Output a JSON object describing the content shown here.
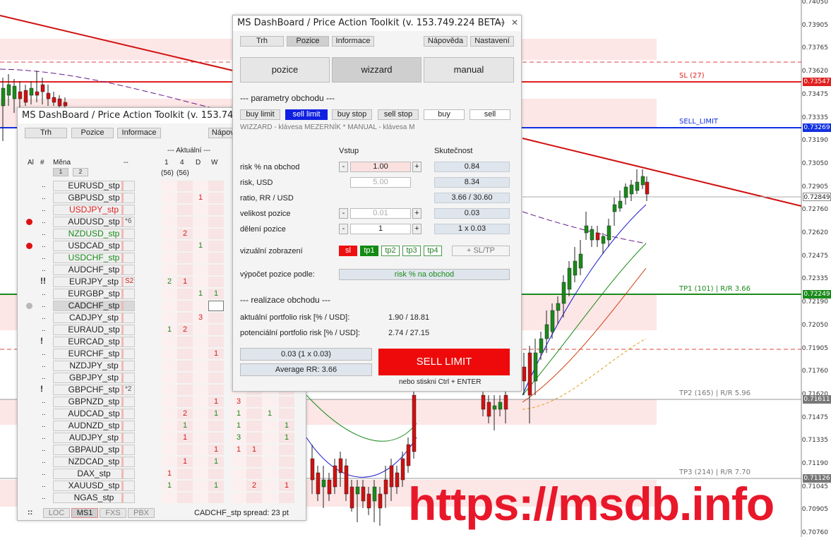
{
  "price_axis": [
    "0.74050",
    "0.73905",
    "0.73765",
    "0.73620",
    "0.73475",
    "0.73335",
    "0.73190",
    "0.73050",
    "0.72905",
    "0.72760",
    "0.72620",
    "0.72475",
    "0.72335",
    "0.72190",
    "0.72050",
    "0.71905",
    "0.71760",
    "0.71620",
    "0.71475",
    "0.71335",
    "0.71190",
    "0.71045",
    "0.70905",
    "0.70760"
  ],
  "levels": {
    "sl": {
      "label": "SL (27)",
      "price": "0.73547",
      "color": "#e02020"
    },
    "sell_limit": {
      "label": "SELL_LIMIT",
      "price": "0.73269",
      "color": "#1030e0"
    },
    "current": {
      "price": "0.72849"
    },
    "tp1": {
      "label": "TP1 (101) | R/R 3.66",
      "price": "0.72249",
      "color": "#1a8a1a"
    },
    "tp2": {
      "label": "TP2 (165) | R/R 5.96",
      "price": "0.71611"
    },
    "tp3": {
      "label": "TP3 (214) | R/R 7.70",
      "price": "0.71126"
    }
  },
  "watermark": "https://msdb.info",
  "back_window": {
    "title": "MS DashBoard / Price Action Toolkit (v. 153.749.224 BETA)",
    "tabs": [
      "Trh",
      "Pozice",
      "Informace",
      "Nápověda"
    ],
    "section_label": "--- Aktuální ---",
    "col_al": "Al",
    "col_hash": "#",
    "col_mena": "Měna",
    "col_dash": "--",
    "page_btns": [
      "1",
      "2"
    ],
    "tf_cols": [
      "1",
      "4",
      "D",
      "W"
    ],
    "counts": [
      "(56)",
      "(56)"
    ],
    "symbols": [
      {
        "name": "EURUSD_stp",
        "color": "#222"
      },
      {
        "name": "GBPUSD_stp",
        "color": "#222",
        "cells": [
          {
            "c": 2,
            "v": "1",
            "color": "#d02020"
          }
        ]
      },
      {
        "name": "USDJPY_stp",
        "color": "#e02020"
      },
      {
        "name": "AUDUSD_stp",
        "color": "#222",
        "dot": "#e01010",
        "note": "*6"
      },
      {
        "name": "NZDUSD_stp",
        "color": "#1a8a1a",
        "cells": [
          {
            "c": 1,
            "v": "2",
            "color": "#d02020"
          }
        ]
      },
      {
        "name": "USDCAD_stp",
        "color": "#222",
        "dot": "#e01010",
        "cells": [
          {
            "c": 2,
            "v": "1",
            "color": "#1a8a1a"
          }
        ]
      },
      {
        "name": "USDCHF_stp",
        "color": "#1a8a1a"
      },
      {
        "name": "AUDCHF_stp",
        "color": "#222"
      },
      {
        "name": "EURJPY_stp",
        "color": "#222",
        "pre": "!!",
        "note": "S2",
        "note_color": "#d02020",
        "cells": [
          {
            "c": 0,
            "v": "2",
            "color": "#1a8a1a"
          },
          {
            "c": 1,
            "v": "1",
            "color": "#d02020"
          }
        ]
      },
      {
        "name": "EURGBP_stp",
        "color": "#222",
        "cells": [
          {
            "c": 2,
            "v": "1",
            "color": "#1a8a1a"
          },
          {
            "c": 3,
            "v": "1",
            "color": "#1a8a1a"
          }
        ]
      },
      {
        "name": "CADCHF_stp",
        "color": "#222",
        "dot": "#b8b8b8",
        "selected": true
      },
      {
        "name": "CADJPY_stp",
        "color": "#222",
        "cells": [
          {
            "c": 2,
            "v": "3",
            "color": "#d02020"
          }
        ]
      },
      {
        "name": "EURAUD_stp",
        "color": "#222",
        "cells": [
          {
            "c": 0,
            "v": "1",
            "color": "#1a8a1a"
          },
          {
            "c": 1,
            "v": "2",
            "color": "#d02020"
          }
        ]
      },
      {
        "name": "EURCAD_stp",
        "color": "#222",
        "pre": "!"
      },
      {
        "name": "EURCHF_stp",
        "color": "#222",
        "cells": [
          {
            "c": 3,
            "v": "1",
            "color": "#d02020"
          }
        ]
      },
      {
        "name": "NZDJPY_stp",
        "color": "#222"
      },
      {
        "name": "GBPJPY_stp",
        "color": "#222"
      },
      {
        "name": "GBPCHF_stp",
        "color": "#222",
        "pre": "!",
        "note": "*2"
      },
      {
        "name": "GBPNZD_stp",
        "color": "#222",
        "cells": [
          {
            "c": 3,
            "v": "1",
            "color": "#d02020"
          },
          {
            "c": 4,
            "v": "3",
            "color": "#d02020"
          }
        ]
      },
      {
        "name": "AUDCAD_stp",
        "color": "#222",
        "cells": [
          {
            "c": 1,
            "v": "2",
            "color": "#d02020"
          },
          {
            "c": 3,
            "v": "1",
            "color": "#1a8a1a"
          },
          {
            "c": 4,
            "v": "1",
            "color": "#1a8a1a"
          },
          {
            "c": 6,
            "v": "1",
            "color": "#1a8a1a"
          }
        ]
      },
      {
        "name": "AUDNZD_stp",
        "color": "#222",
        "cells": [
          {
            "c": 1,
            "v": "1",
            "color": "#1a8a1a"
          },
          {
            "c": 4,
            "v": "1",
            "color": "#1a8a1a"
          },
          {
            "c": 7,
            "v": "1",
            "color": "#1a8a1a"
          }
        ]
      },
      {
        "name": "AUDJPY_stp",
        "color": "#222",
        "cells": [
          {
            "c": 1,
            "v": "1",
            "color": "#d02020"
          },
          {
            "c": 4,
            "v": "3",
            "color": "#1a8a1a"
          },
          {
            "c": 7,
            "v": "1",
            "color": "#1a8a1a"
          }
        ]
      },
      {
        "name": "GBPAUD_stp",
        "color": "#222",
        "cells": [
          {
            "c": 3,
            "v": "1",
            "color": "#d02020"
          },
          {
            "c": 4,
            "v": "1",
            "color": "#d02020"
          },
          {
            "c": 5,
            "v": "1",
            "color": "#d02020"
          }
        ]
      },
      {
        "name": "NZDCAD_stp",
        "color": "#222",
        "cells": [
          {
            "c": 1,
            "v": "1",
            "color": "#d02020"
          },
          {
            "c": 3,
            "v": "1",
            "color": "#1a8a1a"
          }
        ]
      },
      {
        "name": "DAX_stp",
        "color": "#222",
        "cells": [
          {
            "c": 0,
            "v": "1",
            "color": "#d02020"
          }
        ]
      },
      {
        "name": "XAUUSD_stp",
        "color": "#222",
        "cells": [
          {
            "c": 0,
            "v": "1",
            "color": "#1a8a1a"
          },
          {
            "c": 3,
            "v": "1",
            "color": "#1a8a1a"
          },
          {
            "c": 5,
            "v": "2",
            "color": "#d02020"
          },
          {
            "c": 7,
            "v": "1",
            "color": "#d02020"
          }
        ]
      },
      {
        "name": "NGAS_stp",
        "color": "#222"
      }
    ],
    "footer": {
      "grip": "::",
      "tabs": [
        "LOC",
        "MS1",
        "FXS",
        "PBX"
      ],
      "spread": "CADCHF_stp spread: 23 pt"
    }
  },
  "front_window": {
    "title": "MS DashBoard / Price Action Toolkit (v. 153.749.224 BETA)",
    "minimize": "—",
    "close": "✕",
    "tabs": [
      "Trh",
      "Pozice",
      "Informace"
    ],
    "help": "Nápověda",
    "settings": "Nastavení",
    "modes": [
      "pozice",
      "wizzard",
      "manual"
    ],
    "params_title": "--- parametry obchodu ---",
    "order_types": [
      "buy limit",
      "sell limit",
      "buy stop",
      "sell stop",
      "buy",
      "sell"
    ],
    "hint": "WIZZARD - klávesa MEZERNÍK * MANUAL - klávesa M",
    "col_input": "Vstup",
    "col_actual": "Skutečnost",
    "rows": [
      {
        "label": "risk % na obchod",
        "input": "1.00",
        "actual": "0.84"
      },
      {
        "label": "risk, USD",
        "input": "5.00",
        "actual": "8.34"
      },
      {
        "label": "ratio, RR / USD",
        "actual": "3.66 / 30.60"
      },
      {
        "label": "velikost pozice",
        "input": "0.01",
        "actual": "0.03"
      },
      {
        "label": "dělení pozice",
        "input": "1",
        "actual": "1 x 0.03"
      }
    ],
    "minus": "-",
    "plus": "+",
    "visual_label": "vizuální zobrazení",
    "visual_btns": [
      "sl",
      "tp1",
      "tp2",
      "tp3",
      "tp4"
    ],
    "add_sltp": "+ SL/TP",
    "calc_label": "výpočet pozice podle:",
    "calc_value": "risk % na obchod",
    "exec_title": "--- realizace obchodu ---",
    "portfolio_actual_label": "aktuální portfolio risk [% / USD]:",
    "portfolio_actual_value": "1.90 / 18.81",
    "portfolio_potential_label": "potenciální portfolio risk [% / USD]:",
    "portfolio_potential_value": "2.74 / 27.15",
    "summary_size": "0.03 (1 x 0.03)",
    "summary_rr": "Average RR: 3.66",
    "execute": "SELL LIMIT",
    "execute_hint": "nebo stiskni Ctrl + ENTER",
    "execute_color": "#ee0a0a"
  }
}
